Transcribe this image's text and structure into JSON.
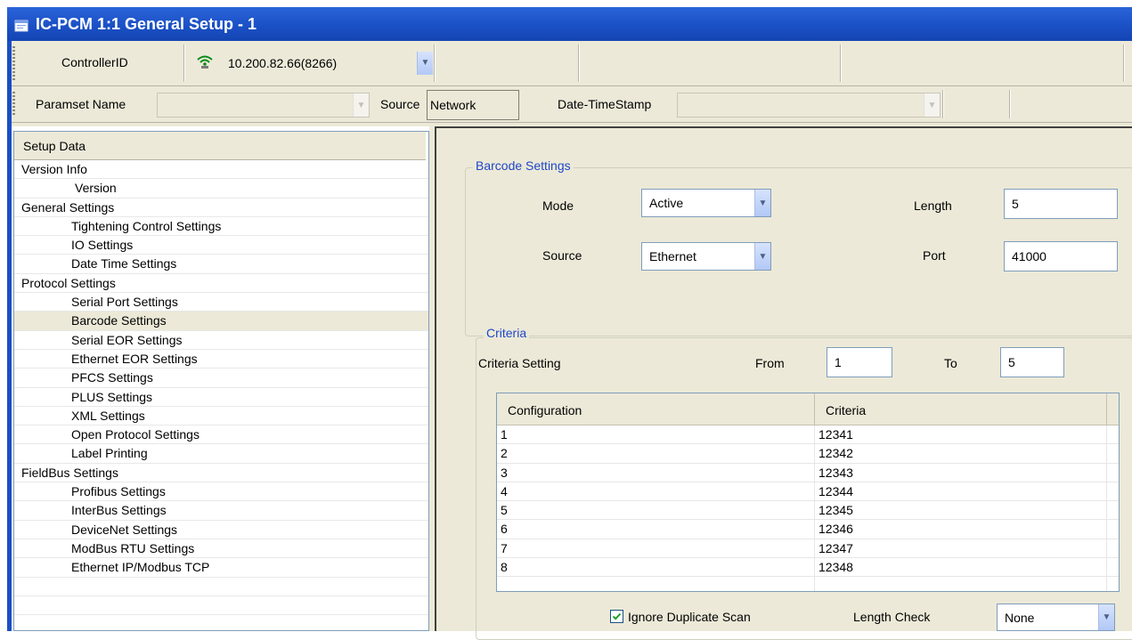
{
  "window": {
    "title": "IC-PCM 1:1 General Setup - 1",
    "icon": "window-icon"
  },
  "toolbar": {
    "controller_label": "ControllerID",
    "controller_value": "10.200.82.66(8266)",
    "controller_icon": "wifi-icon",
    "paramset_label": "Paramset Name",
    "paramset_value": "",
    "source_label": "Source",
    "source_value": "Network",
    "datetime_label": "Date-TimeStamp",
    "datetime_value": ""
  },
  "tree": {
    "header": "Setup Data",
    "items": [
      {
        "label": "Version Info",
        "level": 0
      },
      {
        "label": "Version",
        "level": 1
      },
      {
        "label": "General Settings",
        "level": 0
      },
      {
        "label": "Tightening Control Settings",
        "level": 1
      },
      {
        "label": "IO Settings",
        "level": 1
      },
      {
        "label": "Date Time Settings",
        "level": 1
      },
      {
        "label": "Protocol Settings",
        "level": 0
      },
      {
        "label": "Serial Port Settings",
        "level": 1
      },
      {
        "label": "Barcode Settings",
        "level": 1,
        "selected": true
      },
      {
        "label": "Serial EOR Settings",
        "level": 1
      },
      {
        "label": "Ethernet EOR Settings",
        "level": 1
      },
      {
        "label": "PFCS Settings",
        "level": 1
      },
      {
        "label": "PLUS Settings",
        "level": 1
      },
      {
        "label": "XML Settings",
        "level": 1
      },
      {
        "label": "Open Protocol Settings",
        "level": 1
      },
      {
        "label": "Label Printing",
        "level": 1
      },
      {
        "label": "FieldBus Settings",
        "level": 0
      },
      {
        "label": "Profibus Settings",
        "level": 1
      },
      {
        "label": "InterBus Settings",
        "level": 1
      },
      {
        "label": "DeviceNet Settings",
        "level": 1
      },
      {
        "label": "ModBus RTU Settings",
        "level": 1
      },
      {
        "label": "Ethernet IP/Modbus TCP",
        "level": 1
      }
    ]
  },
  "barcode": {
    "title": "Barcode Settings",
    "mode_label": "Mode",
    "mode_value": "Active",
    "length_label": "Length",
    "length_value": "5",
    "source_label": "Source",
    "source_value": "Ethernet",
    "port_label": "Port",
    "port_value": "41000"
  },
  "criteria": {
    "title": "Criteria",
    "setting_label": "Criteria Setting",
    "from_label": "From",
    "from_value": "1",
    "to_label": "To",
    "to_value": "5",
    "columns": [
      "Configuration",
      "Criteria"
    ],
    "rows": [
      [
        "1",
        "12341"
      ],
      [
        "2",
        "12342"
      ],
      [
        "3",
        "12343"
      ],
      [
        "4",
        "12344"
      ],
      [
        "5",
        "12345"
      ],
      [
        "6",
        "12346"
      ],
      [
        "7",
        "12347"
      ],
      [
        "8",
        "12348"
      ]
    ],
    "ignore_duplicate_label": "Ignore Duplicate Scan",
    "ignore_duplicate_checked": true,
    "length_check_label": "Length Check",
    "length_check_value": "None"
  },
  "colors": {
    "title_bar": "#1a4fc4",
    "group_title": "#1f47c9",
    "panel_bg": "#ece9d8"
  }
}
